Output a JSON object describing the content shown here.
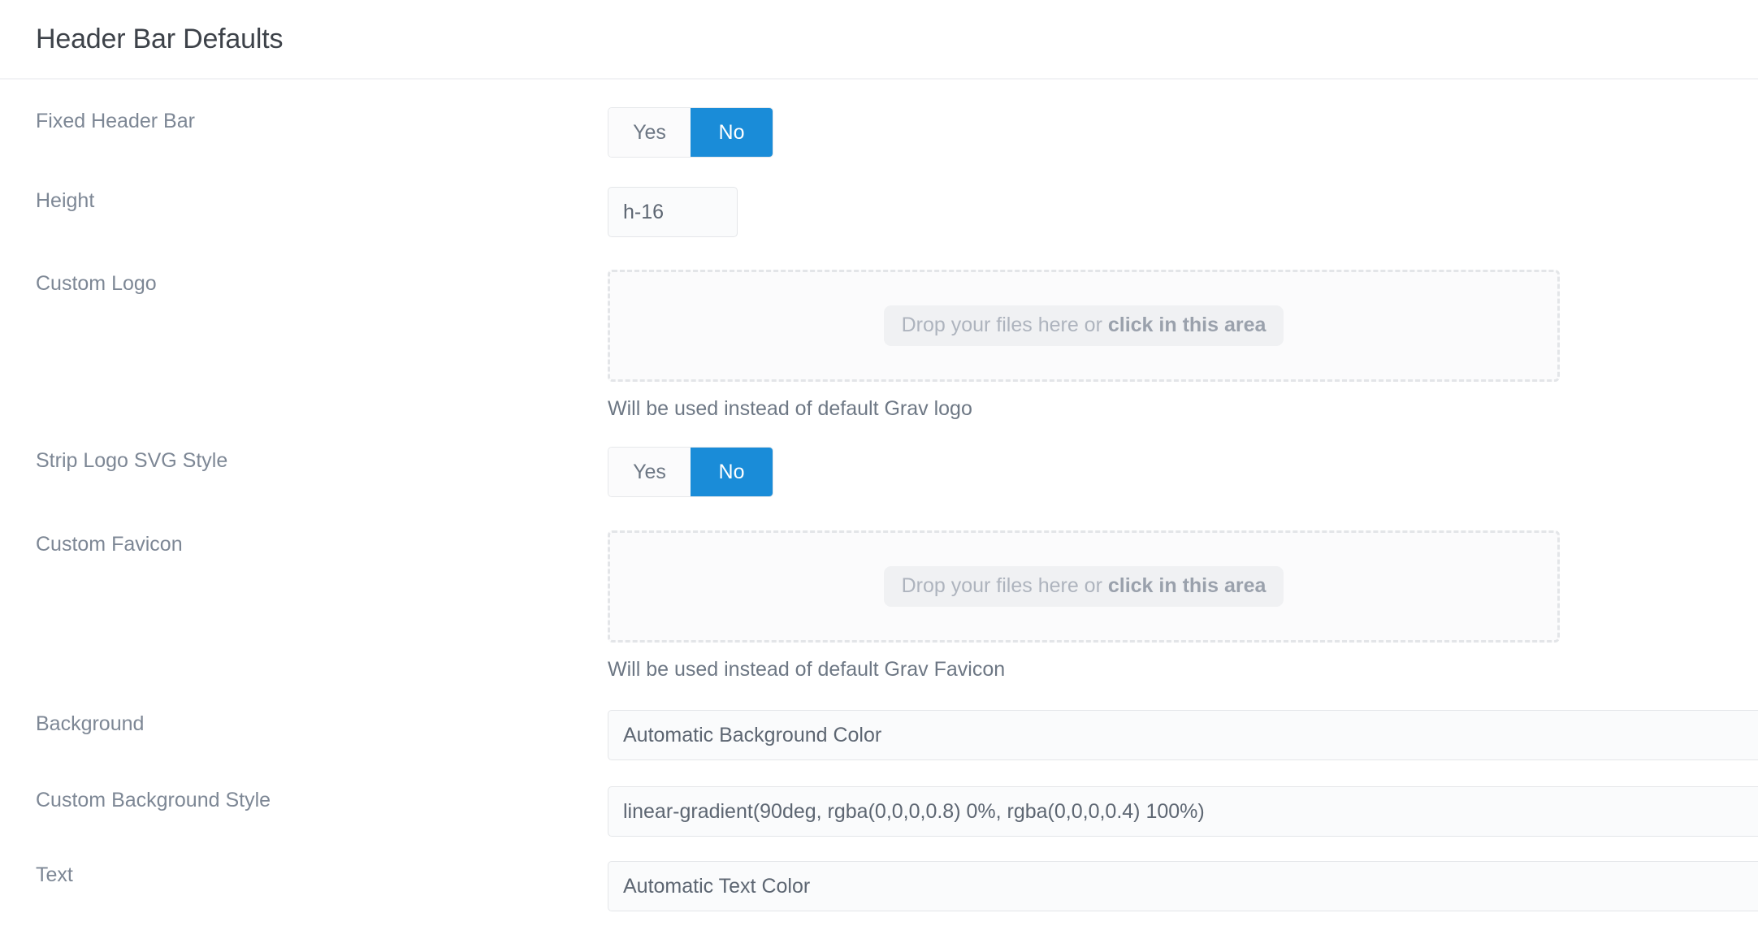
{
  "header": {
    "title": "Header Bar Defaults"
  },
  "colors": {
    "accent_blue": "#1a8cd8",
    "label_gray": "#7d8795",
    "title_dark": "#3d4249",
    "input_bg": "#fafbfc",
    "input_border": "#e4e6e9",
    "dropzone_border": "#e3e5e8",
    "pill_bg": "#f0f1f3",
    "chevron": "#525c6b"
  },
  "fields": {
    "fixed_header_bar": {
      "label": "Fixed Header Bar",
      "type": "toggle",
      "options": [
        "Yes",
        "No"
      ],
      "yes_label": "Yes",
      "no_label": "No",
      "selected": "No"
    },
    "height": {
      "label": "Height",
      "type": "text",
      "value": "h-16",
      "placeholder": ""
    },
    "custom_logo": {
      "label": "Custom Logo",
      "type": "dropzone",
      "prompt_prefix": "Drop your files here or ",
      "prompt_action": "click in this area",
      "help": "Will be used instead of default Grav logo"
    },
    "strip_logo_svg_style": {
      "label": "Strip Logo SVG Style",
      "type": "toggle",
      "options": [
        "Yes",
        "No"
      ],
      "yes_label": "Yes",
      "no_label": "No",
      "selected": "No"
    },
    "custom_favicon": {
      "label": "Custom Favicon",
      "type": "dropzone",
      "prompt_prefix": "Drop your files here or ",
      "prompt_action": "click in this area",
      "help": "Will be used instead of default Grav Favicon"
    },
    "background": {
      "label": "Background",
      "type": "select",
      "value": "Automatic Background Color",
      "icon": "chevron-down-icon"
    },
    "custom_background_style": {
      "label": "Custom Background Style",
      "type": "text",
      "value": "linear-gradient(90deg, rgba(0,0,0,0.8) 0%, rgba(0,0,0,0.4) 100%)",
      "placeholder": ""
    },
    "text": {
      "label": "Text",
      "type": "select",
      "value": "Automatic Text Color",
      "icon": "chevron-down-icon"
    }
  }
}
